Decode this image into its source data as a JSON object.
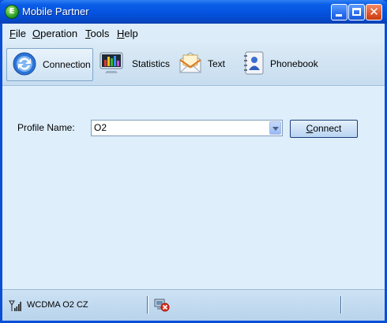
{
  "window": {
    "title": "Mobile Partner",
    "icon": "app-logo-icon",
    "icon_letter": "E"
  },
  "window_buttons": {
    "minimize": "minimize-icon",
    "maximize": "maximize-icon",
    "close": "close-icon",
    "close_glyph": "✕"
  },
  "menu": [
    {
      "first": "F",
      "rest": "ile"
    },
    {
      "first": "O",
      "rest": "peration"
    },
    {
      "first": "T",
      "rest": "ools"
    },
    {
      "first": "H",
      "rest": "elp"
    }
  ],
  "toolbar": [
    {
      "label": "Connection",
      "icon": "connection-icon",
      "active": true
    },
    {
      "label": "Statistics",
      "icon": "statistics-icon",
      "active": false
    },
    {
      "label": "Text",
      "icon": "text-message-icon",
      "active": false
    },
    {
      "label": "Phonebook",
      "icon": "phonebook-icon",
      "active": false
    }
  ],
  "profile": {
    "label": "Profile Name:",
    "value": "O2"
  },
  "connect_button": {
    "first": "C",
    "rest": "onnect"
  },
  "status": {
    "network": "WCDMA  O2 CZ",
    "signal_icon": "signal-strength-icon",
    "modem_icon": "modem-disconnected-icon"
  },
  "colors": {
    "accent": "#0553e0",
    "content_bg": "#deeefb"
  }
}
